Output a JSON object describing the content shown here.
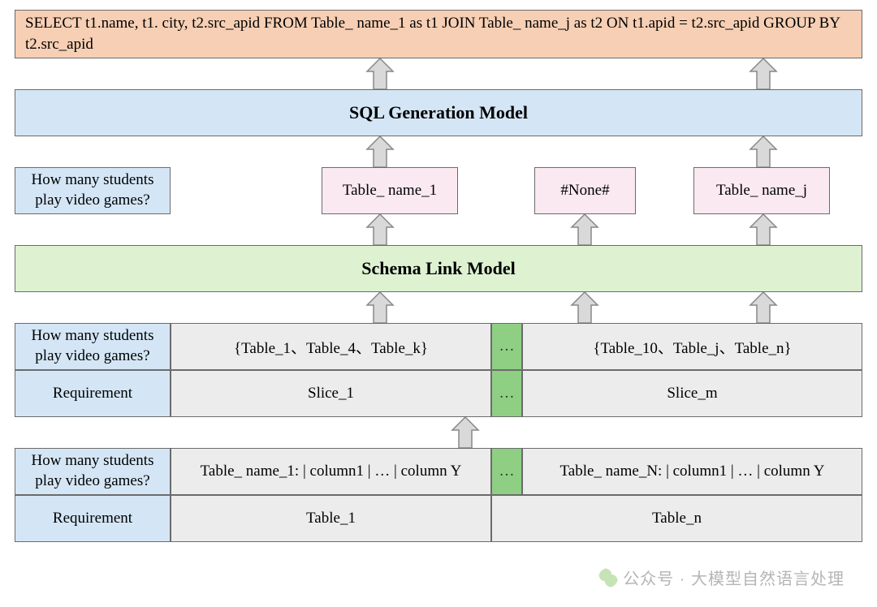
{
  "sql_output": "SELECT t1.name, t1. city, t2.src_apid FROM Table_ name_1 as t1 JOIN Table_ name_j as t2 ON t1.apid = t2.src_apid GROUP BY t2.src_apid",
  "sql_generation_model": "SQL Generation Model",
  "schema_link_model": "Schema Link Model",
  "question": "How many students play video games?",
  "requirement_label": "Requirement",
  "tables_out": {
    "t1": "Table_ name_1",
    "none": "#None#",
    "tj": "Table_ name_j"
  },
  "middle_table": {
    "slice1_tables": "{Table_1、Table_4、Table_k}",
    "slicem_tables": "{Table_10、Table_j、Table_n}",
    "slice1": "Slice_1",
    "slicem": "Slice_m",
    "ellipsis": "…"
  },
  "bottom_table": {
    "col1": "Table_ name_1: | column1 | … | column Y",
    "coln": "Table_ name_N: | column1 | … | column Y",
    "table1": "Table_1",
    "tablen": "Table_n",
    "ellipsis": "…"
  },
  "watermark": "公众号 · 大模型自然语言处理",
  "colors": {
    "sql_output_bg": "#f6cfb4",
    "sql_gen_bg": "#d4e6f6",
    "schema_link_bg": "#def2d2",
    "question_bg": "#d4e6f6",
    "pink_bg": "#fbe9f2",
    "gray_bg": "#ececec",
    "green_bg": "#8ecf84"
  }
}
